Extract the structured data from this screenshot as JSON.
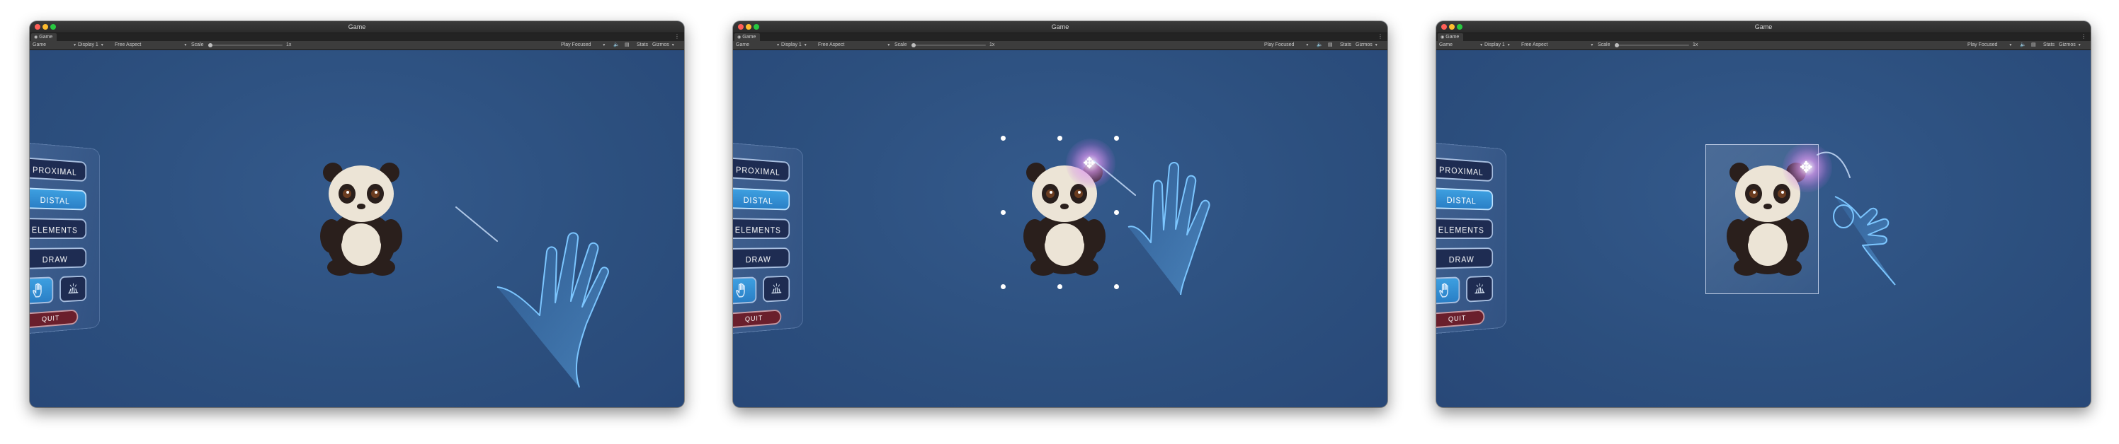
{
  "windows": [
    {
      "title": "Game",
      "tab_label": "Game",
      "toolbar": {
        "game_view": "Game",
        "display": "Display 1",
        "aspect": "Free Aspect",
        "scale_label": "Scale",
        "scale_value": "1x",
        "play_mode": "Play Focused",
        "stats": "Stats",
        "gizmos": "Gizmos"
      },
      "menu": {
        "proximal": "PROXIMAL",
        "distal": "DISTAL",
        "elements": "ELEMENTS",
        "draw": "DRAW",
        "quit": "QUIT"
      }
    },
    {
      "title": "Game",
      "tab_label": "Game",
      "toolbar": {
        "game_view": "Game",
        "display": "Display 1",
        "aspect": "Free Aspect",
        "scale_label": "Scale",
        "scale_value": "1x",
        "play_mode": "Play Focused",
        "stats": "Stats",
        "gizmos": "Gizmos"
      },
      "menu": {
        "proximal": "PROXIMAL",
        "distal": "DISTAL",
        "elements": "ELEMENTS",
        "draw": "DRAW",
        "quit": "QUIT"
      }
    },
    {
      "title": "Game",
      "tab_label": "Game",
      "toolbar": {
        "game_view": "Game",
        "display": "Display 1",
        "aspect": "Free Aspect",
        "scale_label": "Scale",
        "scale_value": "1x",
        "play_mode": "Play Focused",
        "stats": "Stats",
        "gizmos": "Gizmos"
      },
      "menu": {
        "proximal": "PROXIMAL",
        "distal": "DISTAL",
        "elements": "ELEMENTS",
        "draw": "DRAW",
        "quit": "QUIT"
      }
    }
  ],
  "icons": {
    "tab": "eye-icon",
    "mute": "speaker-icon",
    "stats_layout": "layout-icon",
    "grab": "move-arrows-icon"
  },
  "colors": {
    "viewport": "#2c4f7e",
    "active_button": "#2a7fc6",
    "button": "#1e2c52",
    "quit": "#6a1f2c"
  }
}
